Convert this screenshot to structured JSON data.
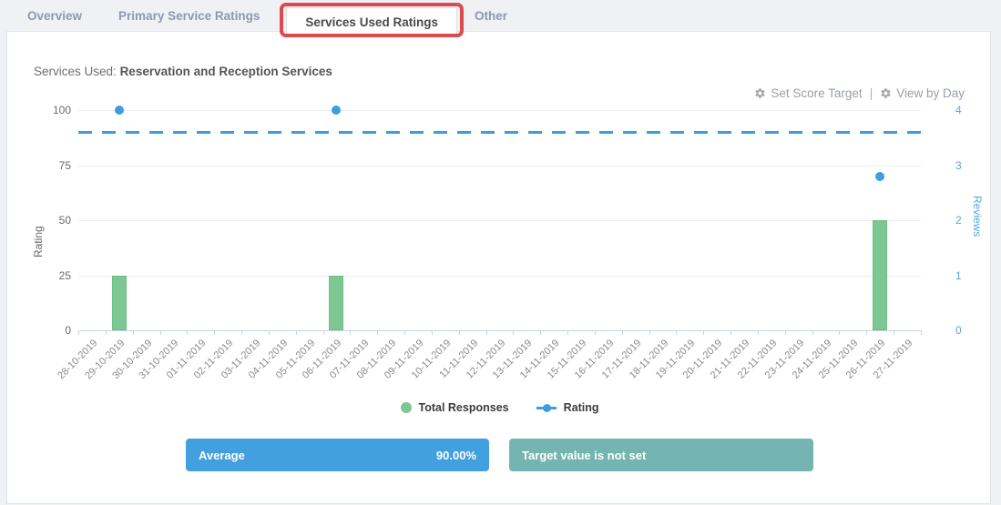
{
  "tabs": {
    "items": [
      {
        "label": "Overview",
        "active": false
      },
      {
        "label": "Primary Service Ratings",
        "active": false
      },
      {
        "label": "Services Used Ratings",
        "active": true
      },
      {
        "label": "Other",
        "active": false
      }
    ],
    "highlight_color": "#dc4b4f"
  },
  "header": {
    "title_prefix": "Services Used:",
    "title_bold": "Reservation and Reception Services"
  },
  "controls": {
    "set_score_target": "Set Score Target",
    "separator": "|",
    "view_by_day": "View by Day",
    "gear_icon_color": "#a6aaae"
  },
  "legend": [
    {
      "label": "Total Responses",
      "marker": "circle",
      "color": "#7cc792"
    },
    {
      "label": "Rating",
      "marker": "line-dot",
      "color": "#3c9edf"
    }
  ],
  "summary": {
    "average_label": "Average",
    "average_value": "90.00%",
    "average_bg": "#42a0de",
    "target_text": "Target value is not set",
    "target_bg": "#74b5b1"
  },
  "chart_data": {
    "type": "combo",
    "categories": [
      "28-10-2019",
      "29-10-2019",
      "30-10-2019",
      "31-10-2019",
      "01-11-2019",
      "02-11-2019",
      "03-11-2019",
      "04-11-2019",
      "05-11-2019",
      "06-11-2019",
      "07-11-2019",
      "08-11-2019",
      "09-11-2019",
      "10-11-2019",
      "11-11-2019",
      "12-11-2019",
      "13-11-2019",
      "14-11-2019",
      "15-11-2019",
      "16-11-2019",
      "17-11-2019",
      "18-11-2019",
      "19-11-2019",
      "20-11-2019",
      "21-11-2019",
      "22-11-2019",
      "23-11-2019",
      "24-11-2019",
      "25-11-2019",
      "26-11-2019",
      "27-11-2019"
    ],
    "series": [
      {
        "name": "Total Responses",
        "type": "bar",
        "axis": "right",
        "color": "#7cc792",
        "values": [
          0,
          1,
          0,
          0,
          0,
          0,
          0,
          0,
          0,
          1,
          0,
          0,
          0,
          0,
          0,
          0,
          0,
          0,
          0,
          0,
          0,
          0,
          0,
          0,
          0,
          0,
          0,
          0,
          0,
          2,
          0
        ]
      },
      {
        "name": "Rating",
        "type": "scatter",
        "axis": "left",
        "color": "#3c9edf",
        "values": [
          null,
          100,
          null,
          null,
          null,
          null,
          null,
          null,
          null,
          100,
          null,
          null,
          null,
          null,
          null,
          null,
          null,
          null,
          null,
          null,
          null,
          null,
          null,
          null,
          null,
          null,
          null,
          null,
          null,
          70,
          null
        ]
      }
    ],
    "average_line": {
      "value": 90,
      "color": "#3c9edf",
      "style": "dashed"
    },
    "left_axis": {
      "label": "Rating",
      "min": 0,
      "max": 100,
      "ticks": [
        0,
        25,
        50,
        75,
        100
      ]
    },
    "right_axis": {
      "label": "Reviews",
      "min": 0,
      "max": 4,
      "ticks": [
        0,
        1,
        2,
        3,
        4
      ]
    },
    "grid": true,
    "legend_position": "bottom"
  }
}
